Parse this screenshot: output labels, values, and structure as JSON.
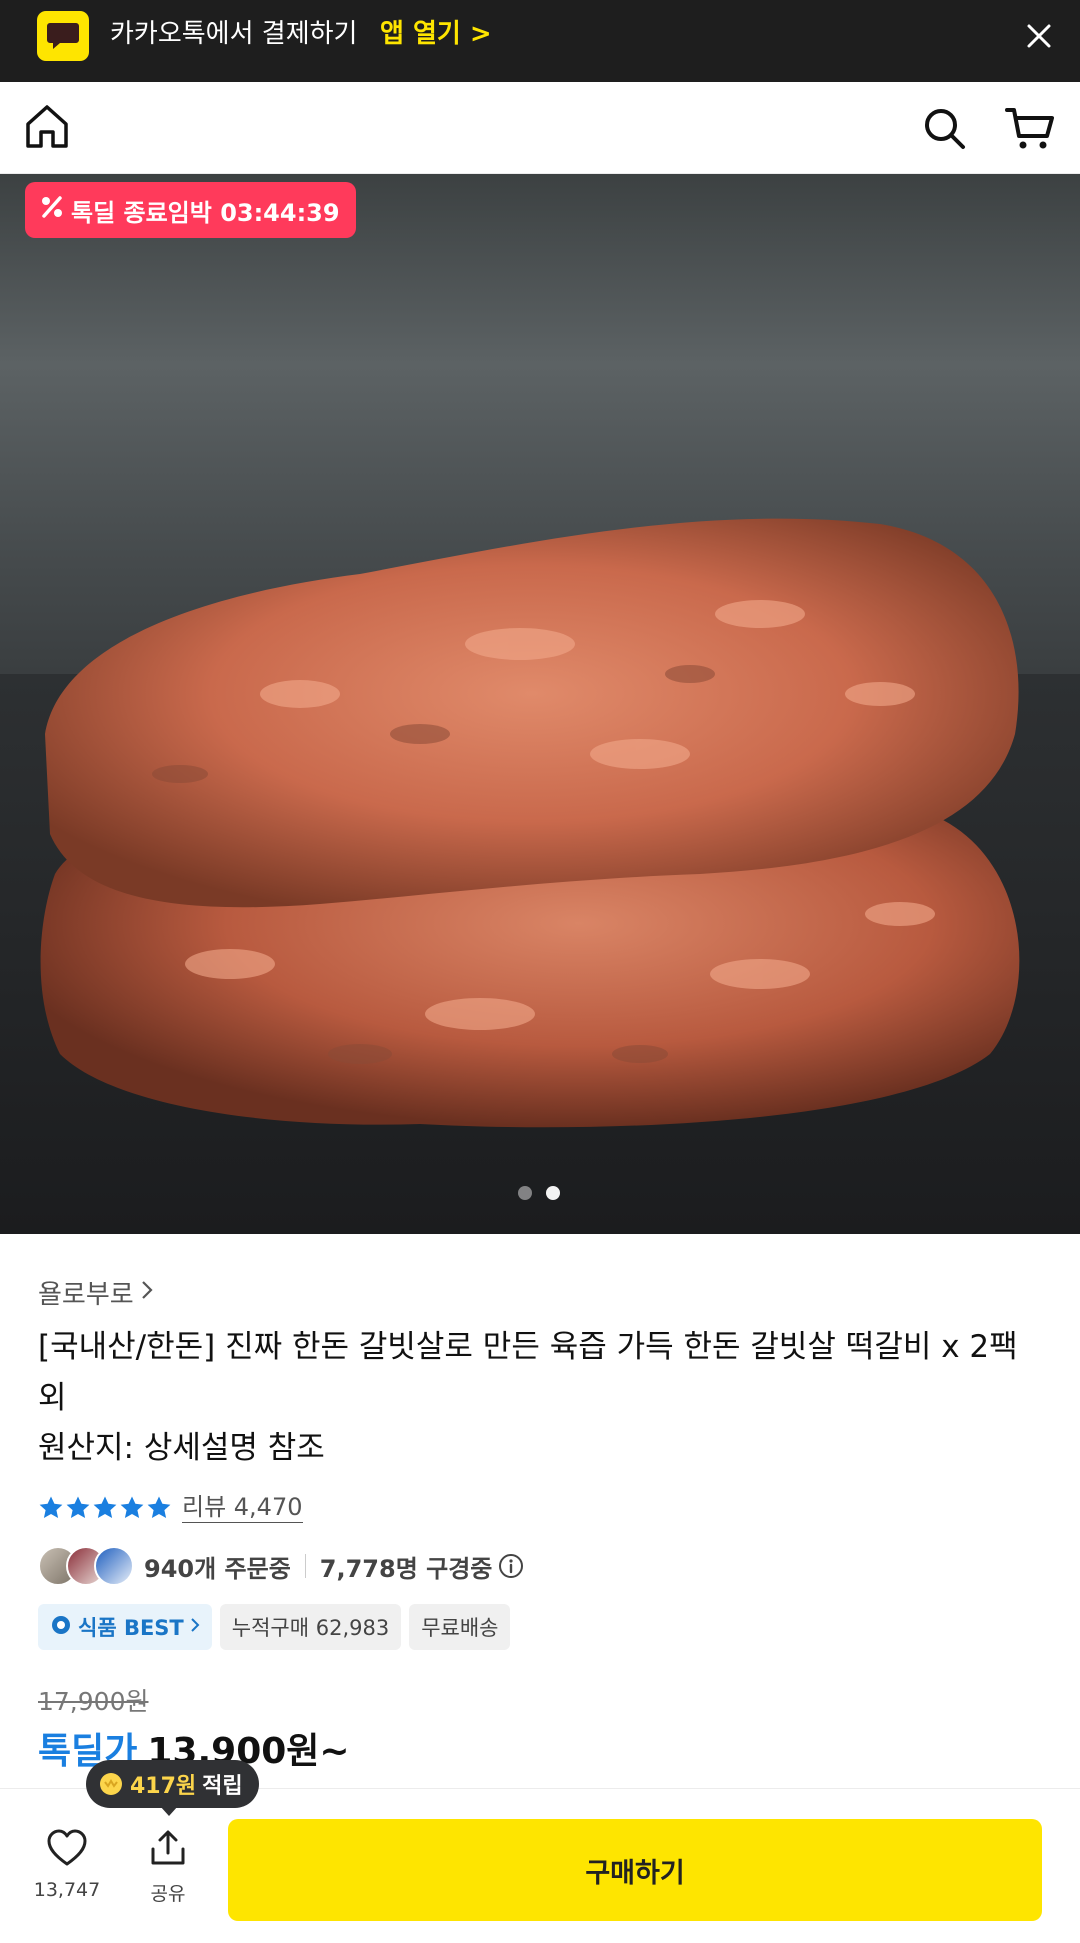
{
  "banner": {
    "text": "카카오톡에서 결제하기",
    "cta": "앱 열기 >",
    "logo_icon": "kakaotalk-speech-bubble-icon",
    "close_icon": "close-icon"
  },
  "navbar": {
    "home_icon": "home-icon",
    "search_icon": "search-icon",
    "cart_icon": "cart-icon"
  },
  "hero": {
    "deal_badge": "톡딜 종료임박 03:44:39",
    "badge_icon": "percent-icon",
    "slide_count": 2,
    "active_slide": 2
  },
  "product": {
    "brand": "욜로부로",
    "title": "[국내산/한돈] 진짜 한돈 갈빗살로 만든 육즙 가득 한돈 갈빗살 떡갈비 x 2팩 외",
    "origin": "원산지: 상세설명 참조",
    "rating_stars": 5,
    "review_label": "리뷰 4,470",
    "orders": "940개 주문중",
    "viewers": "7,778명 구경중",
    "tags": {
      "best": "식품 BEST",
      "cumulative": "누적구매 62,983",
      "shipping": "무료배송"
    },
    "original_price": "17,900원",
    "deal_label": "톡딜가",
    "deal_price": "13,900원~"
  },
  "points": {
    "amount": "417원",
    "suffix": "적립"
  },
  "bottom_bar": {
    "like_count": "13,747",
    "share_label": "공유",
    "buy_label": "구매하기"
  },
  "colors": {
    "kakao_yellow": "#fee500",
    "deal_red": "#ff3a5b",
    "deal_blue": "#1a7fe0",
    "star_blue": "#1a7fe0",
    "banner_bg": "#1e1e1e"
  }
}
